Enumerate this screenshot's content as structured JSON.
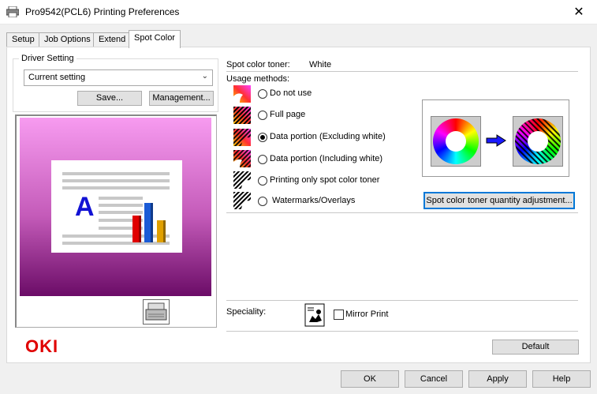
{
  "window": {
    "title": "Pro9542(PCL6) Printing Preferences"
  },
  "tabs": [
    {
      "label": "Setup"
    },
    {
      "label": "Job Options"
    },
    {
      "label": "Extend"
    },
    {
      "label": "Spot Color",
      "active": true
    }
  ],
  "driver_setting": {
    "legend": "Driver Setting",
    "selected": "Current setting",
    "save_label": "Save...",
    "management_label": "Management..."
  },
  "brand": {
    "logo_text": "OKI",
    "color": "#e00000"
  },
  "spot_color": {
    "toner_label": "Spot color toner:",
    "toner_value": "White",
    "usage_label": "Usage methods:",
    "options": [
      {
        "label": "Do not use",
        "icon": "do-not-use-icon",
        "checked": false
      },
      {
        "label": "Full page",
        "icon": "full-page-icon",
        "checked": false
      },
      {
        "label": "Data portion (Excluding white)",
        "icon": "data-excluding-white-icon",
        "checked": true
      },
      {
        "label": "Data portion (Including white)",
        "icon": "data-including-white-icon",
        "checked": false
      },
      {
        "label": "Printing only spot color toner",
        "icon": "spot-only-icon",
        "checked": false
      },
      {
        "label": "Watermarks/Overlays",
        "icon": "watermarks-icon",
        "checked": false
      }
    ],
    "adjust_button": "Spot color toner quantity adjustment..."
  },
  "speciality": {
    "label": "Speciality:",
    "mirror_print": "Mirror Print",
    "mirror_checked": false
  },
  "default_button": "Default",
  "footer": {
    "ok": "OK",
    "cancel": "Cancel",
    "apply": "Apply",
    "help": "Help"
  },
  "colors": {
    "preview_top": "#f79bf0",
    "preview_bottom": "#6b0c67",
    "arrow": "#1a1aff"
  }
}
